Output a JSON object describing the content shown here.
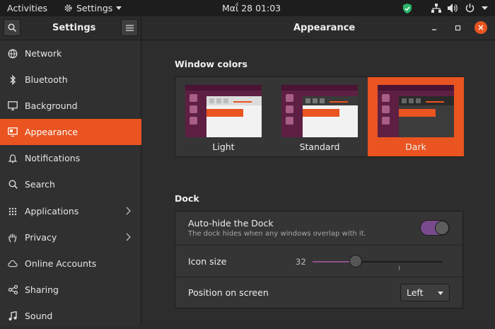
{
  "topbar": {
    "activities": "Activities",
    "app_menu": "Settings",
    "clock": "Μαΐ 28  01:03",
    "tray_icons": [
      "shield-icon",
      "network-icon",
      "volume-icon",
      "power-icon",
      "chevron-down-icon"
    ]
  },
  "window": {
    "sidebar_title": "Settings",
    "page_title": "Appearance"
  },
  "sidebar": {
    "items": [
      {
        "label": "Network",
        "icon": "network-icon"
      },
      {
        "label": "Bluetooth",
        "icon": "bluetooth-icon"
      },
      {
        "label": "Background",
        "icon": "background-icon"
      },
      {
        "label": "Appearance",
        "icon": "appearance-icon",
        "active": true
      },
      {
        "label": "Notifications",
        "icon": "bell-icon"
      },
      {
        "label": "Search",
        "icon": "search-icon"
      },
      {
        "label": "Applications",
        "icon": "apps-grid-icon",
        "has_submenu": true
      },
      {
        "label": "Privacy",
        "icon": "hand-icon",
        "has_submenu": true
      },
      {
        "label": "Online Accounts",
        "icon": "cloud-icon"
      },
      {
        "label": "Sharing",
        "icon": "share-icon"
      },
      {
        "label": "Sound",
        "icon": "music-note-icon"
      }
    ]
  },
  "window_colors": {
    "title": "Window colors",
    "options": [
      {
        "label": "Light"
      },
      {
        "label": "Standard"
      },
      {
        "label": "Dark",
        "selected": true
      }
    ]
  },
  "dock": {
    "title": "Dock",
    "autohide": {
      "label": "Auto-hide the Dock",
      "description": "The dock hides when any windows overlap with it.",
      "enabled": true
    },
    "icon_size": {
      "label": "Icon size",
      "value": "32",
      "fraction": 0.33
    },
    "position": {
      "label": "Position on screen",
      "value": "Left"
    }
  },
  "colors": {
    "accent": "#e95420",
    "toggle_on": "#7a4b8c"
  }
}
